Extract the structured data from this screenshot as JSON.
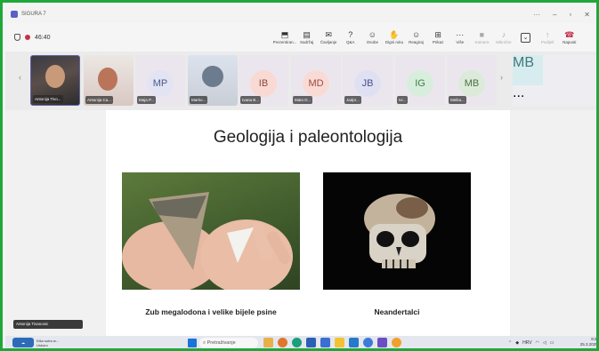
{
  "window": {
    "title": "SIGURA 7"
  },
  "toolbar": {
    "timer": "46:40",
    "tools": [
      {
        "label": "Prezentiran...",
        "icon": "share-screen-icon",
        "dim": false,
        "boxed": false,
        "leave": false
      },
      {
        "label": "Sadržaj",
        "icon": "content-icon",
        "dim": false,
        "boxed": false,
        "leave": false
      },
      {
        "label": "Čavljanje",
        "icon": "chat-icon",
        "dim": false,
        "boxed": false,
        "leave": false
      },
      {
        "label": "Q&A",
        "icon": "qa-icon",
        "dim": false,
        "boxed": false,
        "leave": false
      },
      {
        "label": "Osobe",
        "icon": "people-icon",
        "dim": false,
        "boxed": false,
        "leave": false
      },
      {
        "label": "Digni ruku",
        "icon": "raise-hand-icon",
        "dim": false,
        "boxed": false,
        "leave": false
      },
      {
        "label": "Reagiraj",
        "icon": "react-icon",
        "dim": false,
        "boxed": false,
        "leave": false
      },
      {
        "label": "Prikaz",
        "icon": "view-icon",
        "dim": false,
        "boxed": false,
        "leave": false
      },
      {
        "label": "Više",
        "icon": "more-icon",
        "dim": false,
        "boxed": false,
        "leave": false
      },
      {
        "label": "Kamera",
        "icon": "camera-icon",
        "dim": true,
        "boxed": false,
        "leave": false
      },
      {
        "label": "Mikrofon",
        "icon": "mic-icon",
        "dim": true,
        "boxed": false,
        "leave": false
      },
      {
        "label": "",
        "icon": "chevron-down-icon",
        "dim": false,
        "boxed": true,
        "leave": false
      },
      {
        "label": "Podijeli",
        "icon": "share-icon",
        "dim": true,
        "boxed": false,
        "leave": false
      },
      {
        "label": "Napusti",
        "icon": "leave-icon",
        "dim": false,
        "boxed": false,
        "leave": true
      }
    ]
  },
  "participants": [
    {
      "name": "Antonija Tivo...",
      "initials": "",
      "kind": "photo-a",
      "active": true
    },
    {
      "name": "Antonija Ca...",
      "initials": "",
      "kind": "photo-b",
      "active": false
    },
    {
      "name": "Maja P...",
      "initials": "MP",
      "kind": "init",
      "bg": "#e3e4f3",
      "color": "#4a5a8c",
      "active": false
    },
    {
      "name": "Marko...",
      "initials": "",
      "kind": "photo-c",
      "active": false
    },
    {
      "name": "Ivana B...",
      "initials": "IB",
      "kind": "init",
      "bg": "#f9d9d3",
      "color": "#8a4a3e",
      "active": false
    },
    {
      "name": "Mato D...",
      "initials": "MD",
      "kind": "init",
      "bg": "#f9dbd6",
      "color": "#a1453a",
      "active": false
    },
    {
      "name": "Jadpr...",
      "initials": "JB",
      "kind": "init",
      "bg": "#dfe1f3",
      "color": "#4b4f8c",
      "active": false
    },
    {
      "name": "Ivi...",
      "initials": "IG",
      "kind": "init",
      "bg": "#d8eedc",
      "color": "#3f7a4f",
      "active": false
    },
    {
      "name": "Melita...",
      "initials": "MB",
      "kind": "init",
      "bg": "#dcebd9",
      "color": "#4f6e45",
      "active": false
    }
  ],
  "wide_tile": {
    "initials": "MB",
    "bg": "#d7ecee",
    "color": "#3f7a80",
    "name": "..."
  },
  "slide": {
    "title": "Geologija i paleontologija",
    "caption_left": "Zub megalodona i velike bijele psine",
    "caption_right": "Neandertalci"
  },
  "self_view": {
    "name": "Antonija Tivanovic"
  },
  "taskbar": {
    "weather_line1": "Kiša sutra w...",
    "weather_line2": "Uskoro",
    "search_placeholder": "Pretraživanje",
    "lang": "HRV",
    "time": "8:27",
    "date": "25.3.2025."
  }
}
